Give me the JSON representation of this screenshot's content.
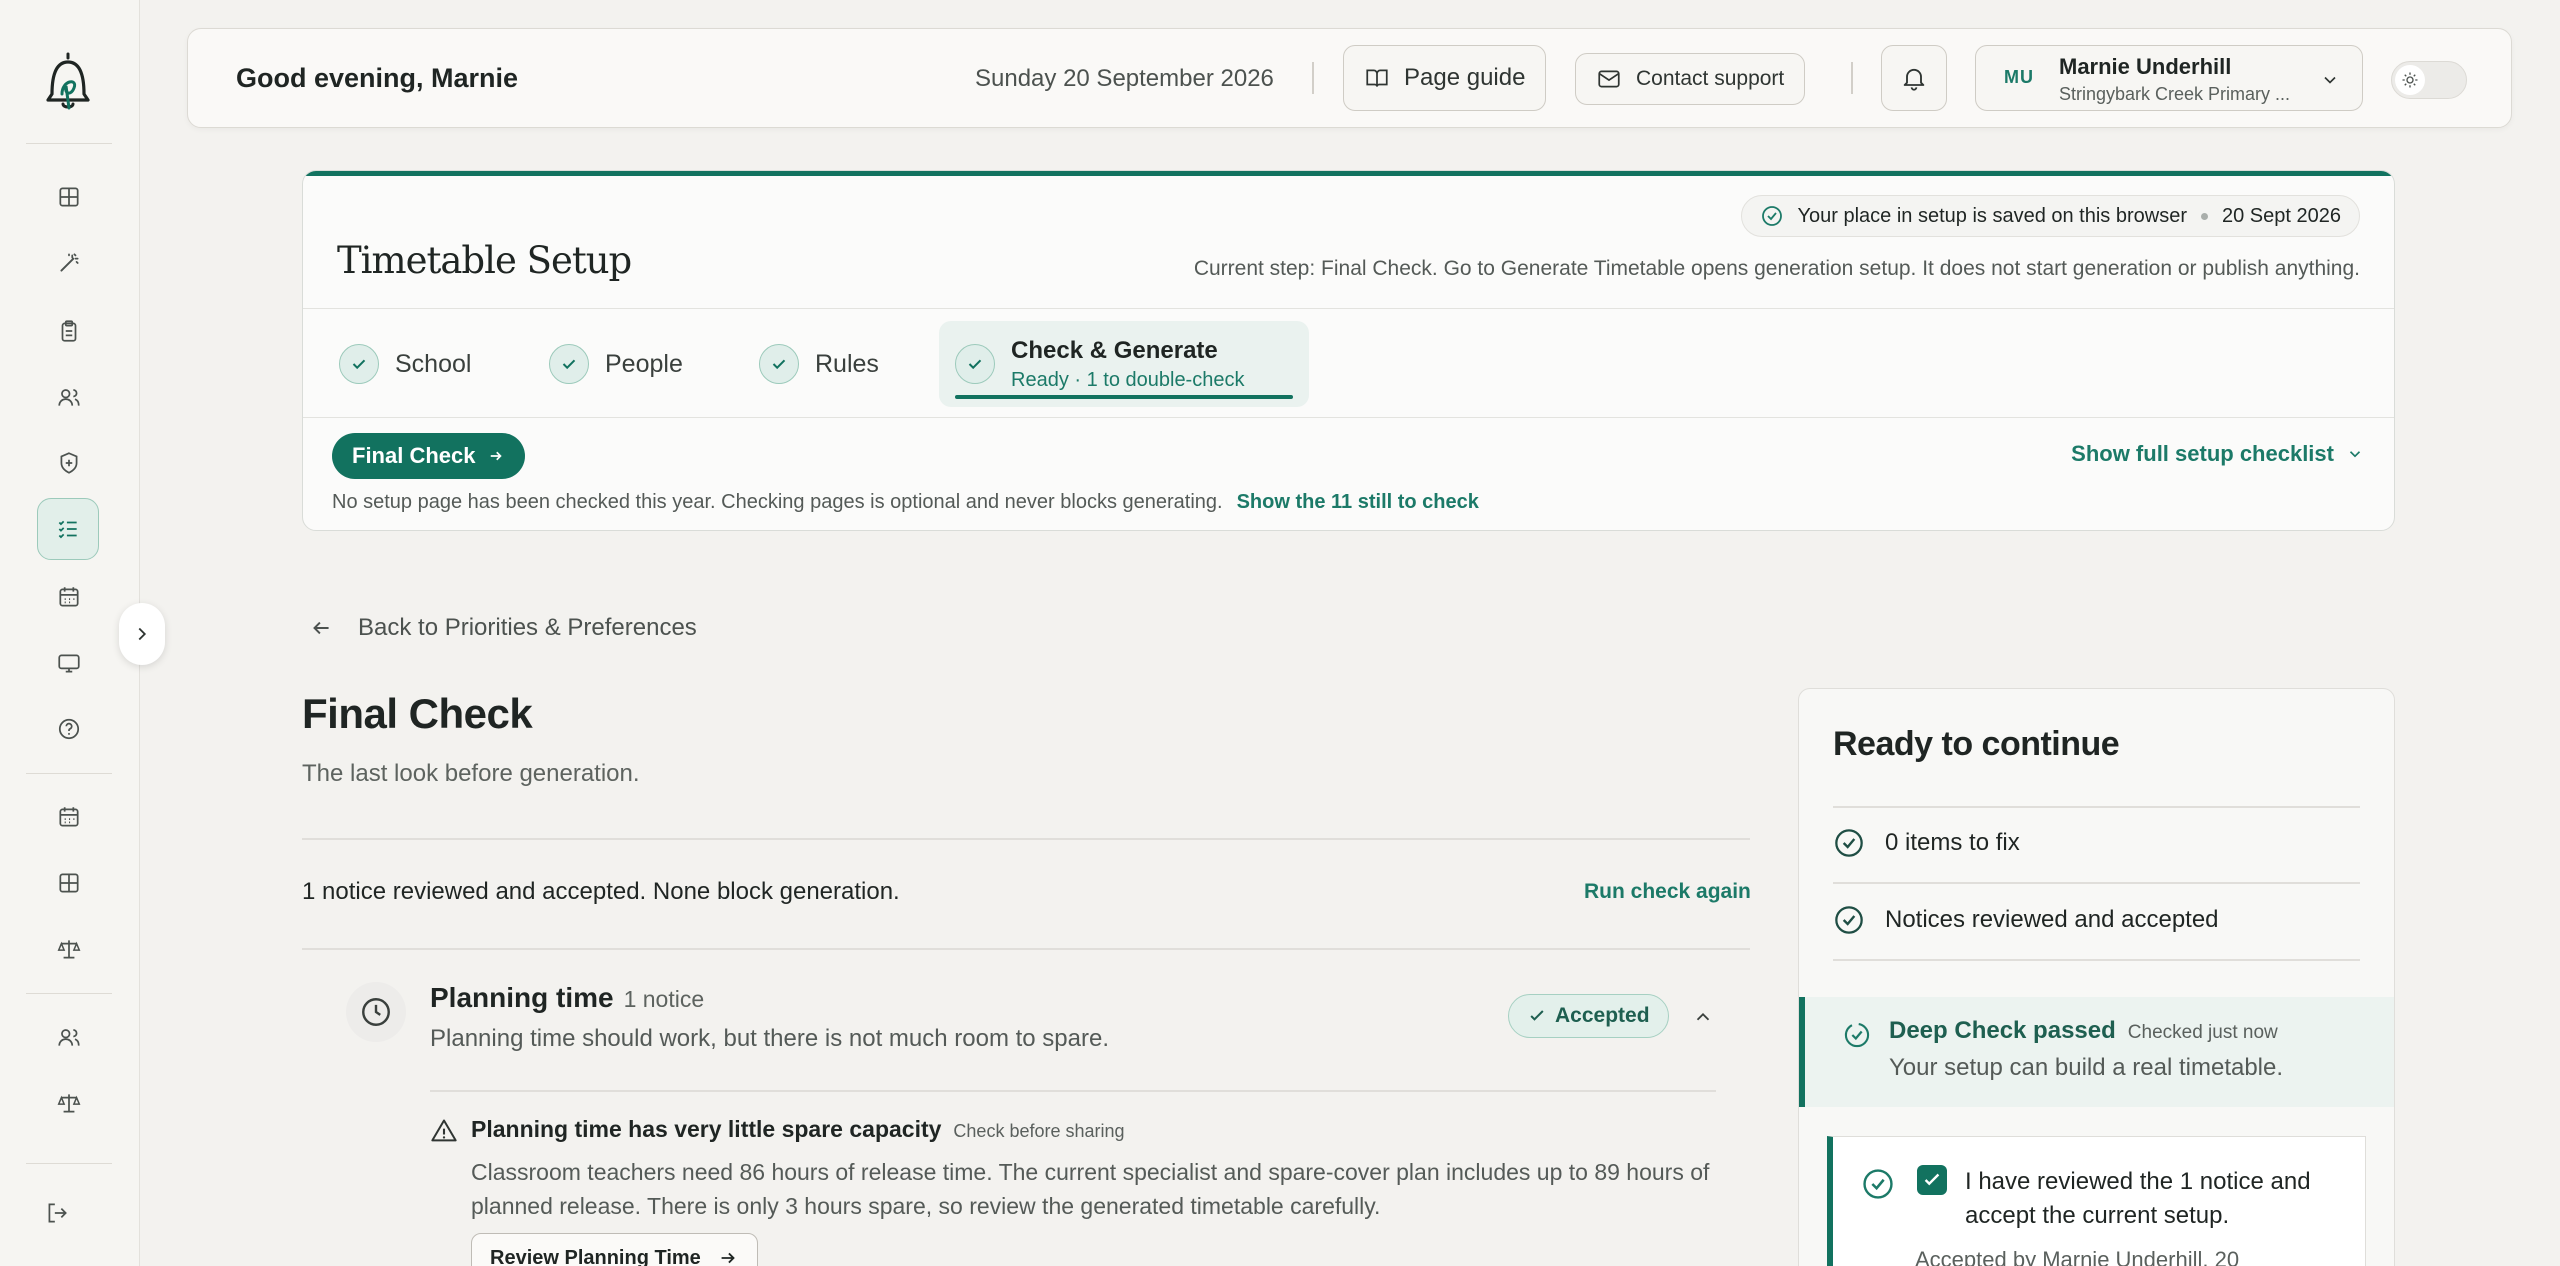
{
  "header": {
    "greeting": "Good evening, Marnie",
    "date": "Sunday 20 September 2026",
    "page_guide": "Page guide",
    "contact_support": "Contact support",
    "user_initials": "MU",
    "user_name": "Marnie Underhill",
    "user_school": "Stringybark Creek Primary ..."
  },
  "setup": {
    "save_status": "Your place in setup is saved on this browser",
    "save_date": "20 Sept 2026",
    "title": "Timetable Setup",
    "current_step": "Current step: Final Check. Go to Generate Timetable opens generation setup. It does not start generation or publish anything.",
    "tabs": [
      {
        "label": "School"
      },
      {
        "label": "People"
      },
      {
        "label": "Rules"
      },
      {
        "label": "Check & Generate",
        "sub": "Ready · 1 to double-check"
      }
    ],
    "final_check_pill": "Final Check",
    "show_checklist": "Show full setup checklist",
    "note": "No setup page has been checked this year. Checking pages is optional and never blocks generating.",
    "note_link": "Show the 11 still to check"
  },
  "back_link": "Back to Priorities & Preferences",
  "main": {
    "title": "Final Check",
    "subtitle": "The last look before generation.",
    "summary": "1 notice reviewed and accepted. None block generation.",
    "run_again": "Run check again",
    "section": {
      "title": "Planning time",
      "count": "1 notice",
      "desc": "Planning time should work, but there is not much room to spare.",
      "badge": "Accepted"
    },
    "notice": {
      "title": "Planning time has very little spare capacity",
      "tag": "Check before sharing",
      "body": "Classroom teachers need 86 hours of release time. The current specialist and spare-cover plan includes up to 89 hours of planned release. There is only 3 hours spare, so review the generated timetable carefully.",
      "button": "Review Planning Time"
    }
  },
  "ready": {
    "title": "Ready to continue",
    "items_to_fix": "0 items to fix",
    "notices": "Notices reviewed and accepted",
    "deep_title": "Deep Check passed",
    "deep_time": "Checked just now",
    "deep_desc": "Your setup can build a real timetable.",
    "ack_text": "I have reviewed the 1 notice and accept the current setup.",
    "ack_by": "Accepted by Marnie Underhill, 20"
  },
  "colors": {
    "accent": "#12725f",
    "accent_text": "#1c7a68",
    "background": "#f3f2ef"
  }
}
